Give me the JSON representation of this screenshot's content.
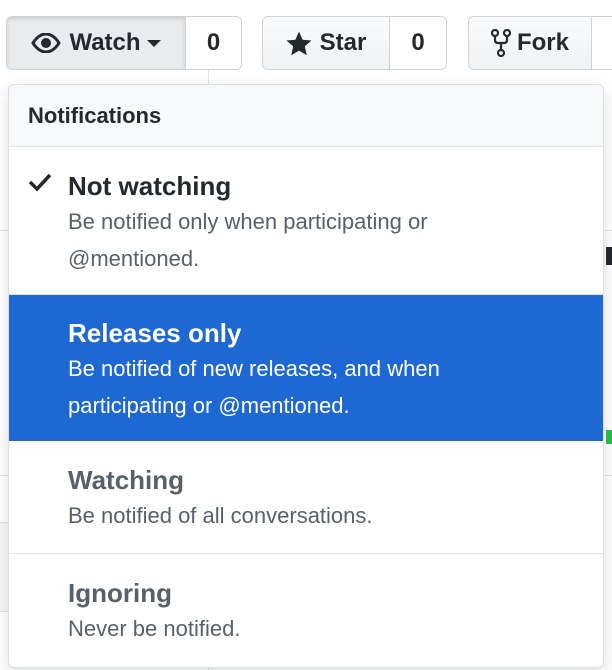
{
  "buttons": {
    "watch": {
      "label": "Watch",
      "count": "0",
      "icon": "eye-icon"
    },
    "star": {
      "label": "Star",
      "count": "0",
      "icon": "star-icon"
    },
    "fork": {
      "label": "Fork",
      "icon": "fork-icon"
    }
  },
  "menu": {
    "header": "Notifications",
    "items": [
      {
        "title": "Not watching",
        "desc1": "Be notified only when participating or",
        "desc2": "@mentioned.",
        "checked": true
      },
      {
        "title": "Releases only",
        "desc1": "Be notified of new releases, and when",
        "desc2": "participating or @mentioned.",
        "selected": true
      },
      {
        "title": "Watching",
        "desc1": "Be notified of all conversations."
      },
      {
        "title": "Ignoring",
        "desc1": "Never be notified."
      }
    ]
  },
  "colors": {
    "selected_bg": "#1e68d3",
    "text_dark": "#24292e",
    "text_muted": "#586069"
  }
}
